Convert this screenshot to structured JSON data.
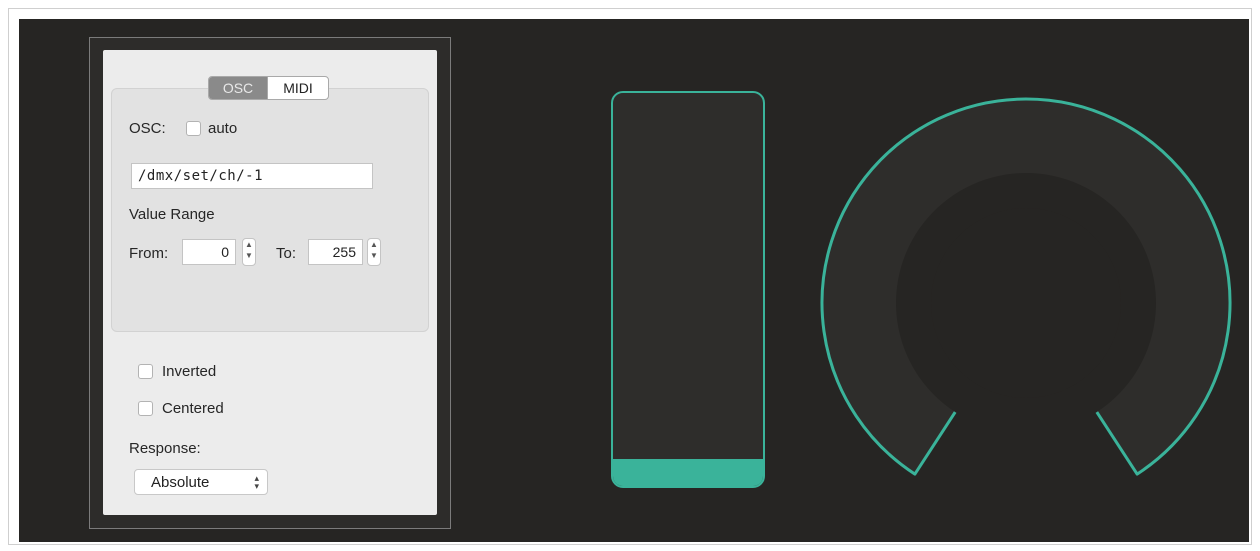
{
  "tabs": [
    {
      "label": "OSC",
      "active": true
    },
    {
      "label": "MIDI",
      "active": false
    }
  ],
  "osc": {
    "label": "OSC:",
    "auto_label": "auto",
    "auto_checked": false,
    "address": "/dmx/set/ch/-1"
  },
  "value_range": {
    "label": "Value Range",
    "from_label": "From:",
    "from_value": "0",
    "to_label": "To:",
    "to_value": "255"
  },
  "options": {
    "inverted_label": "Inverted",
    "inverted_checked": false,
    "centered_label": "Centered",
    "centered_checked": false
  },
  "response": {
    "label": "Response:",
    "value": "Absolute"
  },
  "fader": {
    "level": 0.07
  },
  "knob": {
    "level": 0
  },
  "colors": {
    "accent": "#3ab39a",
    "background": "#262523",
    "panel": "#ececec"
  }
}
